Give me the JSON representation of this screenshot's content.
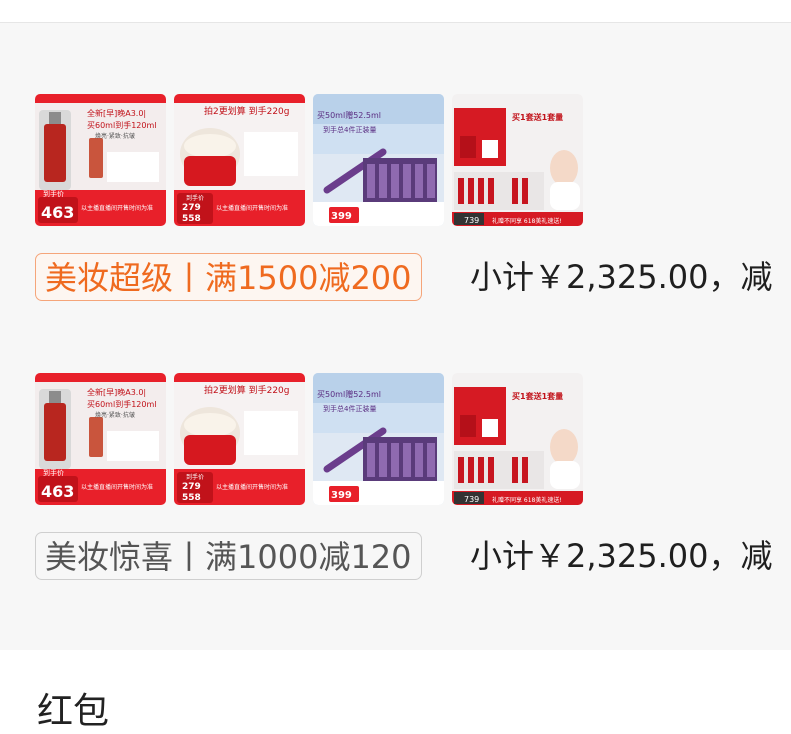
{
  "groups": [
    {
      "tag_label": "美妆超级丨满1500减200",
      "subtotal_text": "小计￥2,325.00，减",
      "products": [
        {
          "headline_1": "全新[早]晚A3.0|",
          "headline_2": "买60ml到手120ml",
          "sub": "焕亮·紧致·抗皱",
          "price_label": "到手价",
          "price": "463",
          "footer": "以主播直播间开售时间为准",
          "theme": "red"
        },
        {
          "headline_1": "拍2更划算 到手220g",
          "headline_2": "",
          "sub": "",
          "price_label": "到手价",
          "price": "279",
          "price_2": "558",
          "footer": "以主播直播间开售时间为准",
          "theme": "red-cream"
        },
        {
          "headline_1": "买50ml赠52.5ml",
          "headline_2": "到手总4件正装量",
          "sub": "",
          "price_label": "",
          "price": "399",
          "footer": "",
          "theme": "purple"
        },
        {
          "headline_1": "买1套送1套量",
          "headline_2": "",
          "sub": "",
          "price_label": "",
          "price": "739",
          "footer": "礼赠不同享 618美礼速送!",
          "theme": "proya"
        }
      ]
    },
    {
      "tag_label": "美妆惊喜丨满1000减120",
      "subtotal_text": "小计￥2,325.00，减",
      "products": [
        {
          "headline_1": "全新[早]晚A3.0|",
          "headline_2": "买60ml到手120ml",
          "sub": "焕亮·紧致·抗皱",
          "price_label": "到手价",
          "price": "463",
          "footer": "以主播直播间开售时间为准",
          "theme": "red"
        },
        {
          "headline_1": "拍2更划算 到手220g",
          "headline_2": "",
          "sub": "",
          "price_label": "到手价",
          "price": "279",
          "price_2": "558",
          "footer": "以主播直播间开售时间为准",
          "theme": "red-cream"
        },
        {
          "headline_1": "买50ml赠52.5ml",
          "headline_2": "到手总4件正装量",
          "sub": "",
          "price_label": "",
          "price": "399",
          "footer": "",
          "theme": "purple"
        },
        {
          "headline_1": "买1套送1套量",
          "headline_2": "",
          "sub": "",
          "price_label": "",
          "price": "739",
          "footer": "礼赠不同享 618美礼速送!",
          "theme": "proya"
        }
      ]
    }
  ],
  "redpacket": {
    "title": "红包"
  },
  "colors": {
    "promo_orange": "#ef6a1f",
    "promo_gray": "#555555",
    "panel_bg": "#f7f7f7",
    "product_red": "#e8202a"
  }
}
